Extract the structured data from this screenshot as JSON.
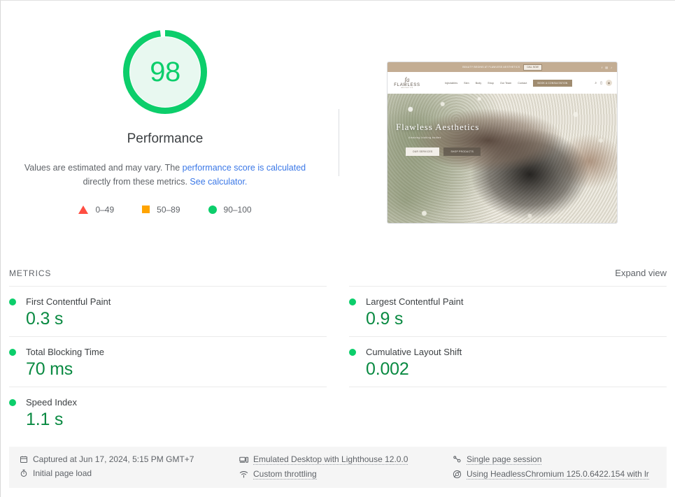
{
  "score": {
    "value": "98",
    "category_label": "Performance",
    "ring_color": "#0cce6b",
    "fill_color": "#e8f8f0"
  },
  "disclaimer": {
    "text_before": "Values are estimated and may vary. The ",
    "link1": "performance score is calculated",
    "text_middle": " directly from these metrics. ",
    "link2": "See calculator.",
    "link_color": "#3b78e7"
  },
  "legend": [
    {
      "shape": "triangle-icon",
      "label": "0–49",
      "color": "#ff4e42"
    },
    {
      "shape": "square-icon",
      "label": "50–89",
      "color": "#ffa400"
    },
    {
      "shape": "circle-icon",
      "label": "90–100",
      "color": "#0cce6b"
    }
  ],
  "thumbnail": {
    "announcement": "BEAUTY BEGINS AT FLAWLESS AESTHETICS",
    "announcement_cta": "CALL NOW",
    "social_icons": [
      "facebook-icon",
      "instagram-icon",
      "tiktok-icon"
    ],
    "logo_mark": "fa",
    "logo_word": "FLAWLESS",
    "logo_sub": "AESTHETICS",
    "nav_items": [
      "Injectables",
      "Skin",
      "Body",
      "Shop",
      "Our Team",
      "Contact"
    ],
    "nav_cta": "BOOK A CONSULTATION",
    "nav_icons": [
      "search-icon",
      "bag-icon",
      "account-icon"
    ],
    "hero_title": "Flawless Aesthetics",
    "hero_subtitle": "Amazing looking bodies",
    "hero_btn_primary": "OUR SERVICES",
    "hero_btn_secondary": "SHOP PRODUCTS"
  },
  "metrics_section": {
    "title": "METRICS",
    "expand_view": "Expand view",
    "items": [
      {
        "label": "First Contentful Paint",
        "value": "0.3 s",
        "status": "pass"
      },
      {
        "label": "Largest Contentful Paint",
        "value": "0.9 s",
        "status": "pass"
      },
      {
        "label": "Total Blocking Time",
        "value": "70 ms",
        "status": "pass"
      },
      {
        "label": "Cumulative Layout Shift",
        "value": "0.002",
        "status": "pass"
      },
      {
        "label": "Speed Index",
        "value": "1.1 s",
        "status": "pass"
      }
    ]
  },
  "environment": {
    "captured_at": "Captured at Jun 17, 2024, 5:15 PM GMT+7",
    "page_load": "Initial page load",
    "emulation": "Emulated Desktop with Lighthouse 12.0.0",
    "throttling": "Custom throttling",
    "session": "Single page session",
    "user_agent": "Using HeadlessChromium 125.0.6422.154 with lr"
  }
}
